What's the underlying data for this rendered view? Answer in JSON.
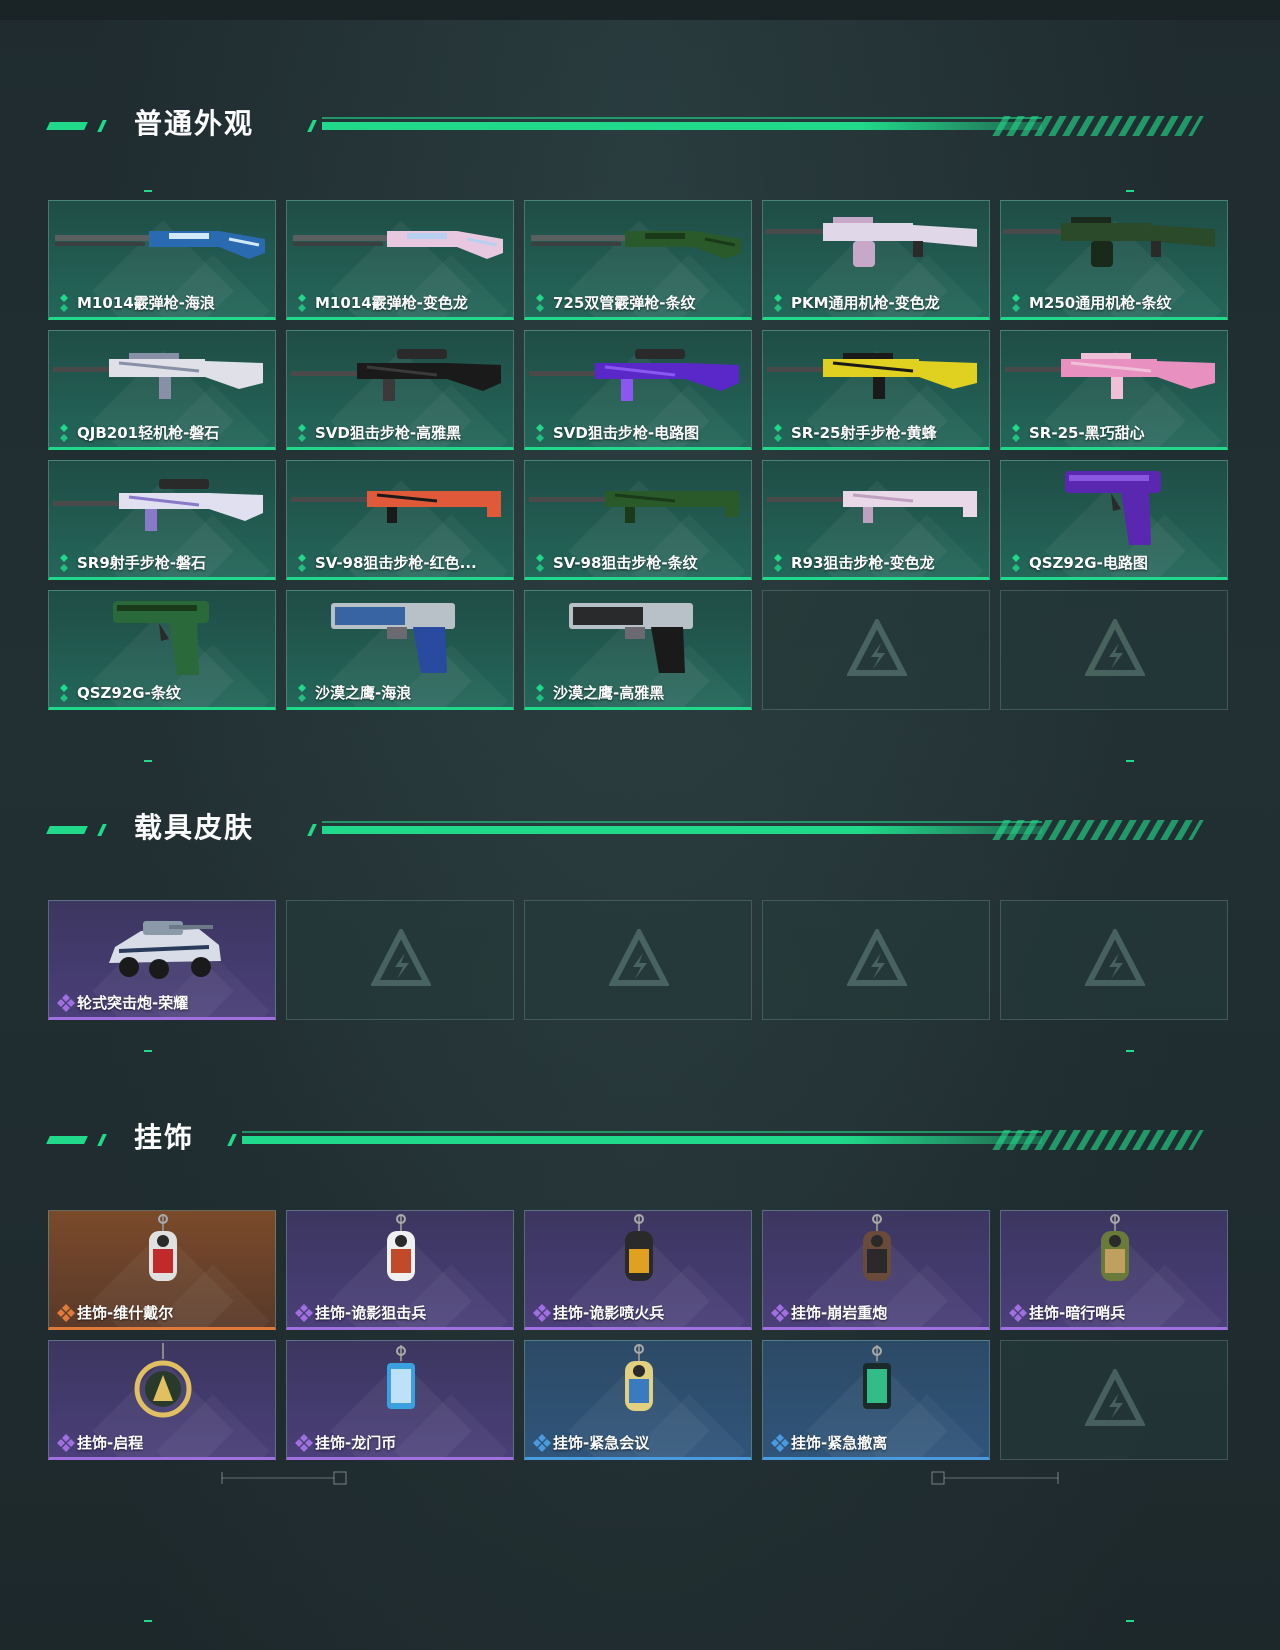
{
  "colors": {
    "accent": "#20d98a",
    "weapon_rarity": "#20d98a",
    "epic_rarity": "#a070e0",
    "legendary_rarity": "#e07a3a",
    "rare_rarity": "#4a9ae0"
  },
  "sections": {
    "normal": {
      "title": "普通外观",
      "items": [
        {
          "label": "M1014霰弹枪-海浪",
          "rarity": "green",
          "art": "shotgun",
          "c1": "#2a6ab0",
          "c2": "#d0e8f8"
        },
        {
          "label": "M1014霰弹枪-变色龙",
          "rarity": "green",
          "art": "shotgun",
          "c1": "#e8c8e0",
          "c2": "#b8d0f0"
        },
        {
          "label": "725双管霰弹枪-条纹",
          "rarity": "green",
          "art": "double",
          "c1": "#2a5a2a",
          "c2": "#1a3a1a"
        },
        {
          "label": "PKM通用机枪-变色龙",
          "rarity": "green",
          "art": "mg",
          "c1": "#e0d8e8",
          "c2": "#c8a8c8"
        },
        {
          "label": "M250通用机枪-条纹",
          "rarity": "green",
          "art": "mg",
          "c1": "#2a4a2a",
          "c2": "#1a2a1a"
        },
        {
          "label": "QJB201轻机枪-磐石",
          "rarity": "green",
          "art": "rifle",
          "c1": "#e0e0e8",
          "c2": "#8890a8"
        },
        {
          "label": "SVD狙击步枪-高雅黑",
          "rarity": "green",
          "art": "sniper",
          "c1": "#1a1a1a",
          "c2": "#3a3a3a"
        },
        {
          "label": "SVD狙击步枪-电路图",
          "rarity": "green",
          "art": "sniper",
          "c1": "#5a28c8",
          "c2": "#8a58f0"
        },
        {
          "label": "SR-25射手步枪-黄蜂",
          "rarity": "green",
          "art": "rifle",
          "c1": "#e0d020",
          "c2": "#1a1a1a"
        },
        {
          "label": "SR-25-黑巧甜心",
          "rarity": "green",
          "art": "rifle",
          "c1": "#e890c0",
          "c2": "#f0c0d8"
        },
        {
          "label": "SR9射手步枪-磐石",
          "rarity": "green",
          "art": "sniper",
          "c1": "#e0e0f0",
          "c2": "#8a78c8"
        },
        {
          "label": "SV-98狙击步枪-红色...",
          "rarity": "green",
          "art": "bolt",
          "c1": "#e05a3a",
          "c2": "#1a1a1a"
        },
        {
          "label": "SV-98狙击步枪-条纹",
          "rarity": "green",
          "art": "bolt",
          "c1": "#2a5a2a",
          "c2": "#1a3a1a"
        },
        {
          "label": "R93狙击步枪-变色龙",
          "rarity": "green",
          "art": "bolt",
          "c1": "#e8d8e8",
          "c2": "#c0a0c0"
        },
        {
          "label": "QSZ92G-电路图",
          "rarity": "green",
          "art": "pistol",
          "c1": "#5a28b0",
          "c2": "#8a58e0"
        },
        {
          "label": "QSZ92G-条纹",
          "rarity": "green",
          "art": "pistol",
          "c1": "#2a6a3a",
          "c2": "#1a3a1a"
        },
        {
          "label": "沙漠之鹰-海浪",
          "rarity": "green",
          "art": "deagle",
          "c1": "#2a5aa0",
          "c2": "#d0e0f0"
        },
        {
          "label": "沙漠之鹰-高雅黑",
          "rarity": "green",
          "art": "deagle",
          "c1": "#1a1a1a",
          "c2": "#3a3a3a"
        }
      ],
      "empty_slots": 2
    },
    "vehicle": {
      "title": "载具皮肤",
      "items": [
        {
          "label": "轮式突击炮-荣耀",
          "rarity": "purple",
          "art": "vehicle",
          "c1": "#d8dde8",
          "c2": "#2a3a5a"
        }
      ],
      "empty_slots": 4
    },
    "charm": {
      "title": "挂饰",
      "items": [
        {
          "label": "挂饰-维什戴尔",
          "rarity": "orange",
          "art": "charm",
          "c1": "#e0e0e0",
          "c2": "#c02a2a"
        },
        {
          "label": "挂饰-诡影狙击兵",
          "rarity": "purple",
          "art": "charm",
          "c1": "#f0f0f0",
          "c2": "#c04a2a"
        },
        {
          "label": "挂饰-诡影喷火兵",
          "rarity": "purple",
          "art": "charm",
          "c1": "#2a2a2a",
          "c2": "#e0a020"
        },
        {
          "label": "挂饰-崩岩重炮",
          "rarity": "purple",
          "art": "charm",
          "c1": "#6a4a3a",
          "c2": "#2a2a2a"
        },
        {
          "label": "挂饰-暗行哨兵",
          "rarity": "purple",
          "art": "charm",
          "c1": "#6a7a3a",
          "c2": "#c0a060"
        },
        {
          "label": "挂饰-启程",
          "rarity": "purple",
          "art": "ring",
          "c1": "#2a3a2a",
          "c2": "#e0c060"
        },
        {
          "label": "挂饰-龙门币",
          "rarity": "purple",
          "art": "tag",
          "c1": "#3aa0e0",
          "c2": "#e0f0ff"
        },
        {
          "label": "挂饰-紧急会议",
          "rarity": "blue",
          "art": "charm",
          "c1": "#e0d080",
          "c2": "#3a7ac0"
        },
        {
          "label": "挂饰-紧急撤离",
          "rarity": "blue",
          "art": "tag",
          "c1": "#1a2a2a",
          "c2": "#3ae0a0"
        }
      ],
      "empty_slots": 1
    }
  },
  "icons": {
    "rarity_green": "diamond-stack-icon",
    "rarity_purple": "four-diamond-icon",
    "rarity_orange": "four-diamond-icon",
    "rarity_blue": "four-diamond-icon",
    "empty_slot": "game-logo-icon"
  }
}
